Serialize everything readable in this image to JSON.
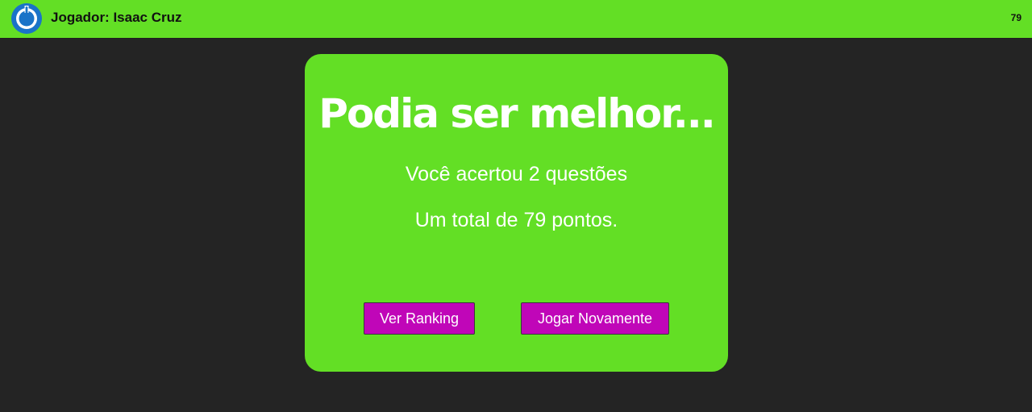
{
  "header": {
    "player_label": "Jogador: Isaac Cruz",
    "score": "79",
    "logo_icon": "power-icon",
    "background_color": "#63df25",
    "logo_color": "#1a73c8"
  },
  "result": {
    "title": "Podia ser melhor...",
    "correct_text": "Você acertou 2 questões",
    "total_text": "Um total de 79 pontos.",
    "card_color": "#63df25"
  },
  "actions": {
    "ranking_label": "Ver Ranking",
    "play_again_label": "Jogar Novamente",
    "button_color": "#c006b8"
  }
}
